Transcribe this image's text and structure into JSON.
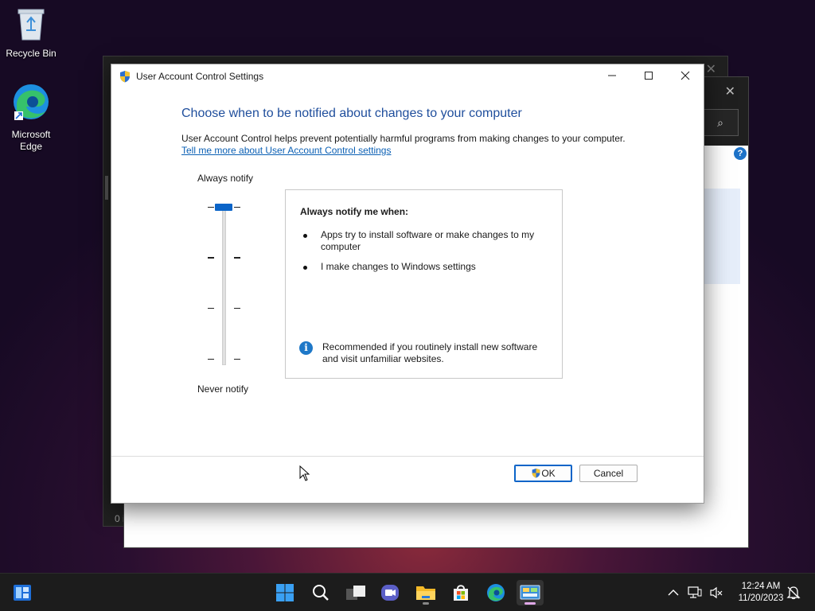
{
  "desktop": {
    "icons": [
      {
        "label": "Recycle Bin",
        "icon": "recycle-bin-icon"
      },
      {
        "label": "Microsoft Edge",
        "icon": "edge-icon"
      }
    ],
    "background_window_text": "0 i"
  },
  "dialog": {
    "title": "User Account Control Settings",
    "heading": "Choose when to be notified about changes to your computer",
    "description": "User Account Control helps prevent potentially harmful programs from making changes to your computer.",
    "learn_more_link": "Tell me more about User Account Control settings",
    "slider": {
      "top_label": "Always notify",
      "bottom_label": "Never notify",
      "levels": 4,
      "current_level": 4
    },
    "info": {
      "title": "Always notify me when:",
      "bullets": [
        "Apps try to install software or make changes to my computer",
        "I make changes to Windows settings"
      ],
      "recommendation": "Recommended if you routinely install new software and visit unfamiliar websites."
    },
    "buttons": {
      "ok": "OK",
      "cancel": "Cancel"
    }
  },
  "taskbar": {
    "apps": [
      "start-icon",
      "search-icon",
      "task-view-icon",
      "teams-chat-icon",
      "file-explorer-icon",
      "store-icon",
      "edge-icon",
      "control-panel-icon"
    ],
    "active_app": "control-panel-icon",
    "clock": {
      "time": "12:24 AM",
      "date": "11/20/2023"
    }
  },
  "colors": {
    "accent": "#0a64c8",
    "heading": "#1f4e9c",
    "link": "#0a5fb4"
  }
}
